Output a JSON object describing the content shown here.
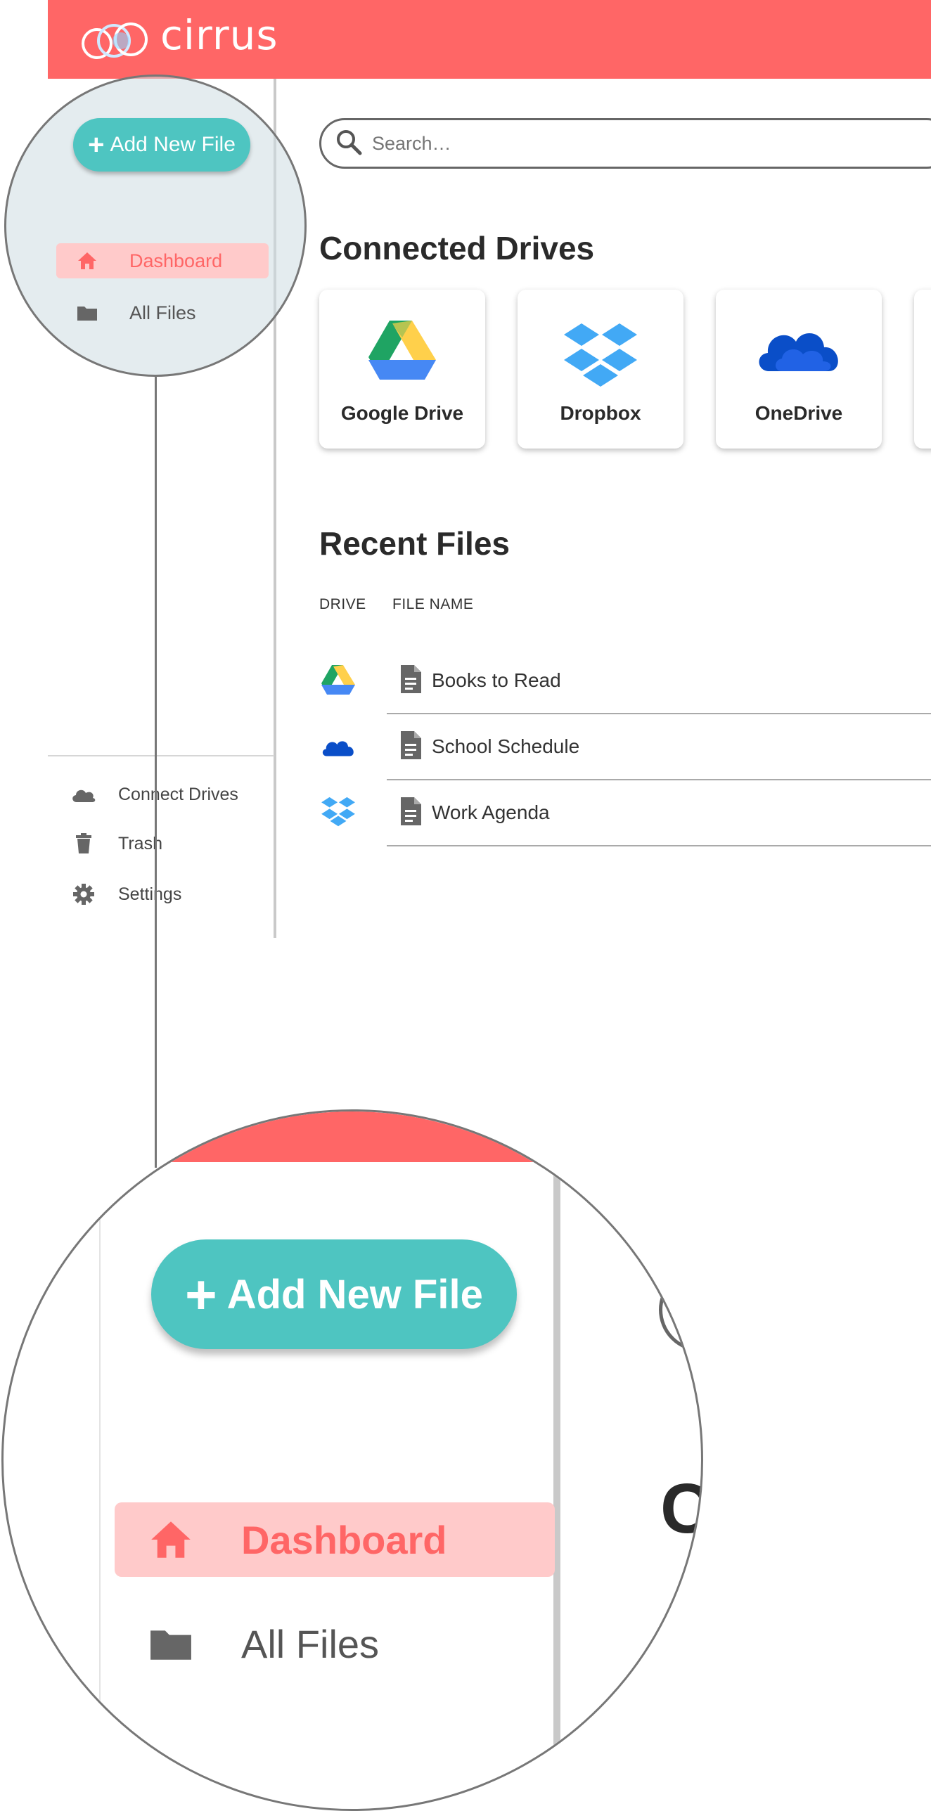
{
  "header": {
    "app_title": "cirrus",
    "brand_color": "#ff6666",
    "logo_icon": "cirrus-logo-icon"
  },
  "sidebar": {
    "add_button": {
      "label": "Add New File",
      "color": "#4ec5c1"
    },
    "nav": [
      {
        "label": "Dashboard",
        "icon": "home-icon",
        "active": true
      },
      {
        "label": "All Files",
        "icon": "folder-icon",
        "active": false
      }
    ],
    "bottom": [
      {
        "label": "Connect Drives",
        "icon": "cloud-icon"
      },
      {
        "label": "Trash",
        "icon": "trash-icon"
      },
      {
        "label": "Settings",
        "icon": "gear-icon"
      }
    ]
  },
  "search": {
    "placeholder": "Search…"
  },
  "connected_drives": {
    "title": "Connected Drives",
    "drives": [
      {
        "label": "Google Drive",
        "icon": "google-drive-icon"
      },
      {
        "label": "Dropbox",
        "icon": "dropbox-icon"
      },
      {
        "label": "OneDrive",
        "icon": "onedrive-icon"
      }
    ]
  },
  "recent_files": {
    "title": "Recent Files",
    "columns": [
      "DRIVE",
      "FILE NAME"
    ],
    "rows": [
      {
        "drive_icon": "google-drive-icon",
        "name": "Books to Read"
      },
      {
        "drive_icon": "onedrive-icon",
        "name": "School Schedule"
      },
      {
        "drive_icon": "dropbox-icon",
        "name": "Work Agenda"
      }
    ]
  },
  "zoom": {
    "add_button_label": "Add New File",
    "nav": [
      "Dashboard",
      "All Files"
    ],
    "peek_letter": "C"
  }
}
